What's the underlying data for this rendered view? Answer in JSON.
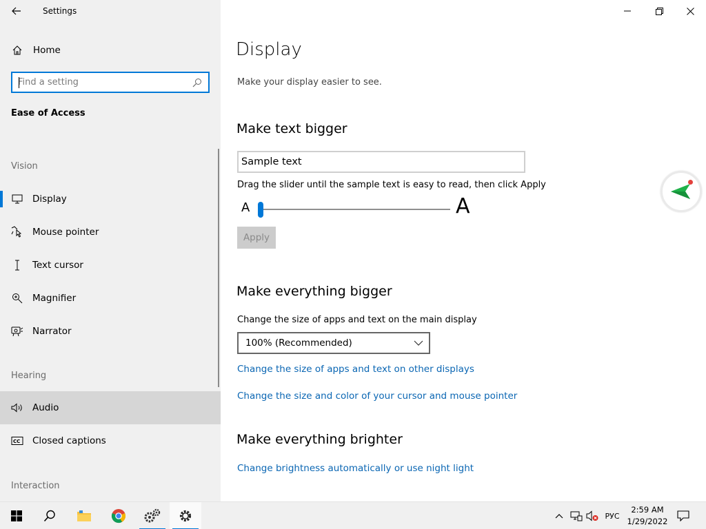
{
  "window": {
    "title": "Settings"
  },
  "sidebar": {
    "home_label": "Home",
    "search_placeholder": "Find a setting",
    "section_title": "Ease of Access",
    "groups": {
      "vision": "Vision",
      "hearing": "Hearing",
      "interaction": "Interaction"
    },
    "items": [
      {
        "label": "Display",
        "icon": "monitor-icon",
        "state": "selected"
      },
      {
        "label": "Mouse pointer",
        "icon": "mouse-pointer-icon"
      },
      {
        "label": "Text cursor",
        "icon": "text-cursor-icon"
      },
      {
        "label": "Magnifier",
        "icon": "magnifier-icon"
      },
      {
        "label": "Narrator",
        "icon": "narrator-icon"
      },
      {
        "label": "Audio",
        "icon": "speaker-icon",
        "state": "hover"
      },
      {
        "label": "Closed captions",
        "icon": "cc-icon"
      }
    ]
  },
  "main": {
    "title": "Display",
    "subtitle": "Make your display easier to see.",
    "text_bigger": {
      "heading": "Make text bigger",
      "sample": "Sample text",
      "instruction": "Drag the slider until the sample text is easy to read, then click Apply",
      "small_label": "A",
      "large_label": "A",
      "slider_value": 0,
      "apply_label": "Apply"
    },
    "everything_bigger": {
      "heading": "Make everything bigger",
      "label": "Change the size of apps and text on the main display",
      "dropdown_value": "100% (Recommended)",
      "link_other_displays": "Change the size of apps and text on other displays",
      "link_cursor": "Change the size and color of your cursor and mouse pointer"
    },
    "everything_brighter": {
      "heading": "Make everything brighter",
      "link_brightness": "Change brightness automatically or use night light"
    }
  },
  "taskbar": {
    "language": "РУС",
    "time": "2:59 AM",
    "date": "1/29/2022"
  },
  "colors": {
    "accent": "#0078d7",
    "link": "#0a66b3",
    "sidebar_bg": "#f0f0f0"
  }
}
